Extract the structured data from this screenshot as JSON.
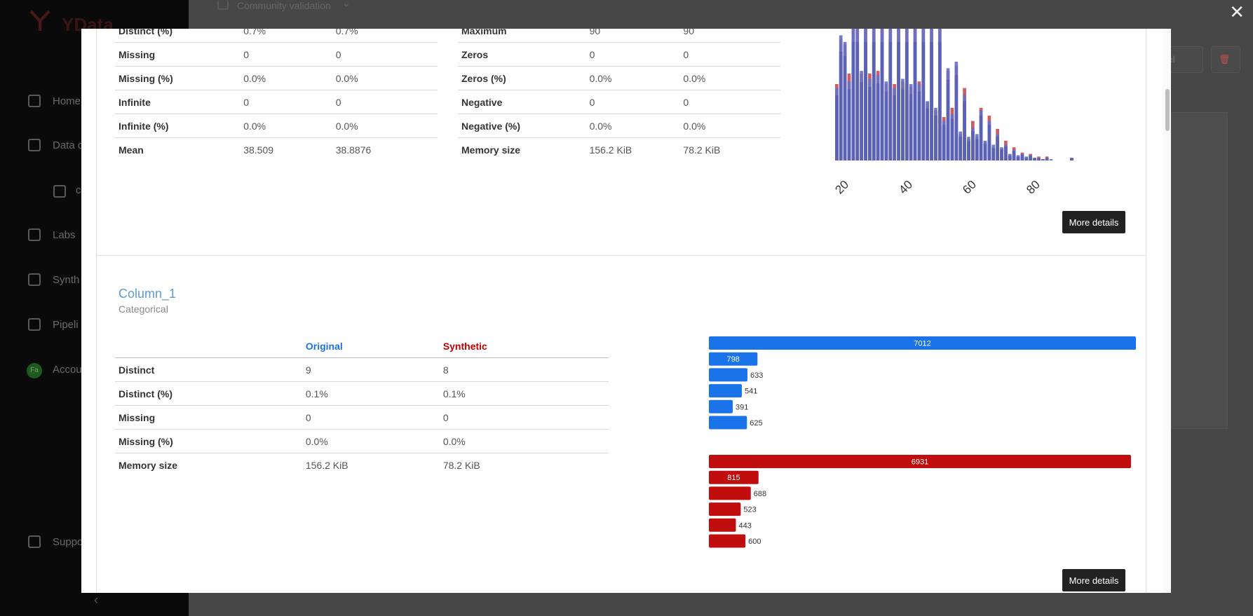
{
  "app": {
    "logo": "YData",
    "breadcrumb": "Community validation",
    "nav": [
      "Home",
      "Data c",
      "c",
      "Labs",
      "Synth",
      "Pipeli",
      "Accou",
      "Suppo"
    ],
    "avatar_initials": "Fa",
    "header_button": "odel"
  },
  "top_section": {
    "left_rows": [
      {
        "label": "Distinct (%)",
        "original": "0.7%",
        "synthetic": "0.7%"
      },
      {
        "label": "Missing",
        "original": "0",
        "synthetic": "0"
      },
      {
        "label": "Missing (%)",
        "original": "0.0%",
        "synthetic": "0.0%"
      },
      {
        "label": "Infinite",
        "original": "0",
        "synthetic": "0"
      },
      {
        "label": "Infinite (%)",
        "original": "0.0%",
        "synthetic": "0.0%"
      },
      {
        "label": "Mean",
        "original": "38.509",
        "synthetic": "38.8876"
      }
    ],
    "right_rows": [
      {
        "label": "Maximum",
        "original": "90",
        "synthetic": "90"
      },
      {
        "label": "Zeros",
        "original": "0",
        "synthetic": "0"
      },
      {
        "label": "Zeros (%)",
        "original": "0.0%",
        "synthetic": "0.0%"
      },
      {
        "label": "Negative",
        "original": "0",
        "synthetic": "0"
      },
      {
        "label": "Negative (%)",
        "original": "0.0%",
        "synthetic": "0.0%"
      },
      {
        "label": "Memory size",
        "original": "156.2 KiB",
        "synthetic": "78.2 KiB"
      }
    ],
    "more_details": "More details",
    "histogram_ticks": [
      "20",
      "40",
      "60",
      "80"
    ]
  },
  "column": {
    "name": "Column_1",
    "type": "Categorical",
    "header_original": "Original",
    "header_synthetic": "Synthetic",
    "rows": [
      {
        "label": "Distinct",
        "original": "9",
        "synthetic": "8"
      },
      {
        "label": "Distinct (%)",
        "original": "0.1%",
        "synthetic": "0.1%"
      },
      {
        "label": "Missing",
        "original": "0",
        "synthetic": "0"
      },
      {
        "label": "Missing (%)",
        "original": "0.0%",
        "synthetic": "0.0%"
      },
      {
        "label": "Memory size",
        "original": "156.2 KiB",
        "synthetic": "78.2 KiB"
      }
    ],
    "more_details": "More details"
  },
  "chart_data": [
    {
      "type": "bar",
      "title": "",
      "x_ticks": [
        20,
        40,
        60,
        80
      ],
      "xlim": [
        17,
        92
      ],
      "ylim": [
        0,
        1
      ],
      "series": [
        {
          "color": "#6672c8",
          "values": [
            0.55,
            0.95,
            0.9,
            0.6,
            1,
            1,
            0.68,
            1,
            0.62,
            1,
            0.65,
            1,
            0.6,
            1,
            0.55,
            1,
            0.62,
            1,
            0.58,
            1,
            0.58,
            1,
            0.45,
            1,
            0.4,
            1,
            0.3,
            0.7,
            0.35,
            0.75,
            0.22,
            0.5,
            0.18,
            0.25,
            0.2,
            0.38,
            0.15,
            0.3,
            0.12,
            0.2,
            0.1,
            0.12,
            0.05,
            0.08,
            0.04,
            0.05,
            0.03,
            0.04,
            0.02,
            0.02,
            0.01,
            0.02,
            0.01,
            0.0,
            0.0,
            0.0,
            0.0,
            0.02
          ]
        },
        {
          "color": "#ce5d5d",
          "values": [
            0.58,
            0.92,
            0.88,
            0.66,
            1,
            1,
            0.66,
            1,
            0.66,
            1,
            0.68,
            1,
            0.58,
            1,
            0.58,
            1,
            0.6,
            1,
            0.56,
            1,
            0.6,
            1,
            0.44,
            1,
            0.38,
            1,
            0.33,
            0.68,
            0.4,
            0.72,
            0.2,
            0.55,
            0.16,
            0.3,
            0.18,
            0.4,
            0.14,
            0.34,
            0.1,
            0.24,
            0.09,
            0.15,
            0.04,
            0.1,
            0.03,
            0.06,
            0.02,
            0.05,
            0.02,
            0.03,
            0.01,
            0.03,
            0.0,
            0.0,
            0.0,
            0.0,
            0.0,
            0.02
          ]
        }
      ]
    },
    {
      "type": "bar",
      "orientation": "horizontal",
      "series": [
        {
          "name": "Original",
          "color": "#1a73e8",
          "values": [
            7012,
            798,
            633,
            541,
            391,
            625
          ]
        },
        {
          "name": "Synthetic",
          "color": "#c00d0d",
          "values": [
            6931,
            815,
            688,
            523,
            443,
            600
          ]
        }
      ]
    }
  ]
}
